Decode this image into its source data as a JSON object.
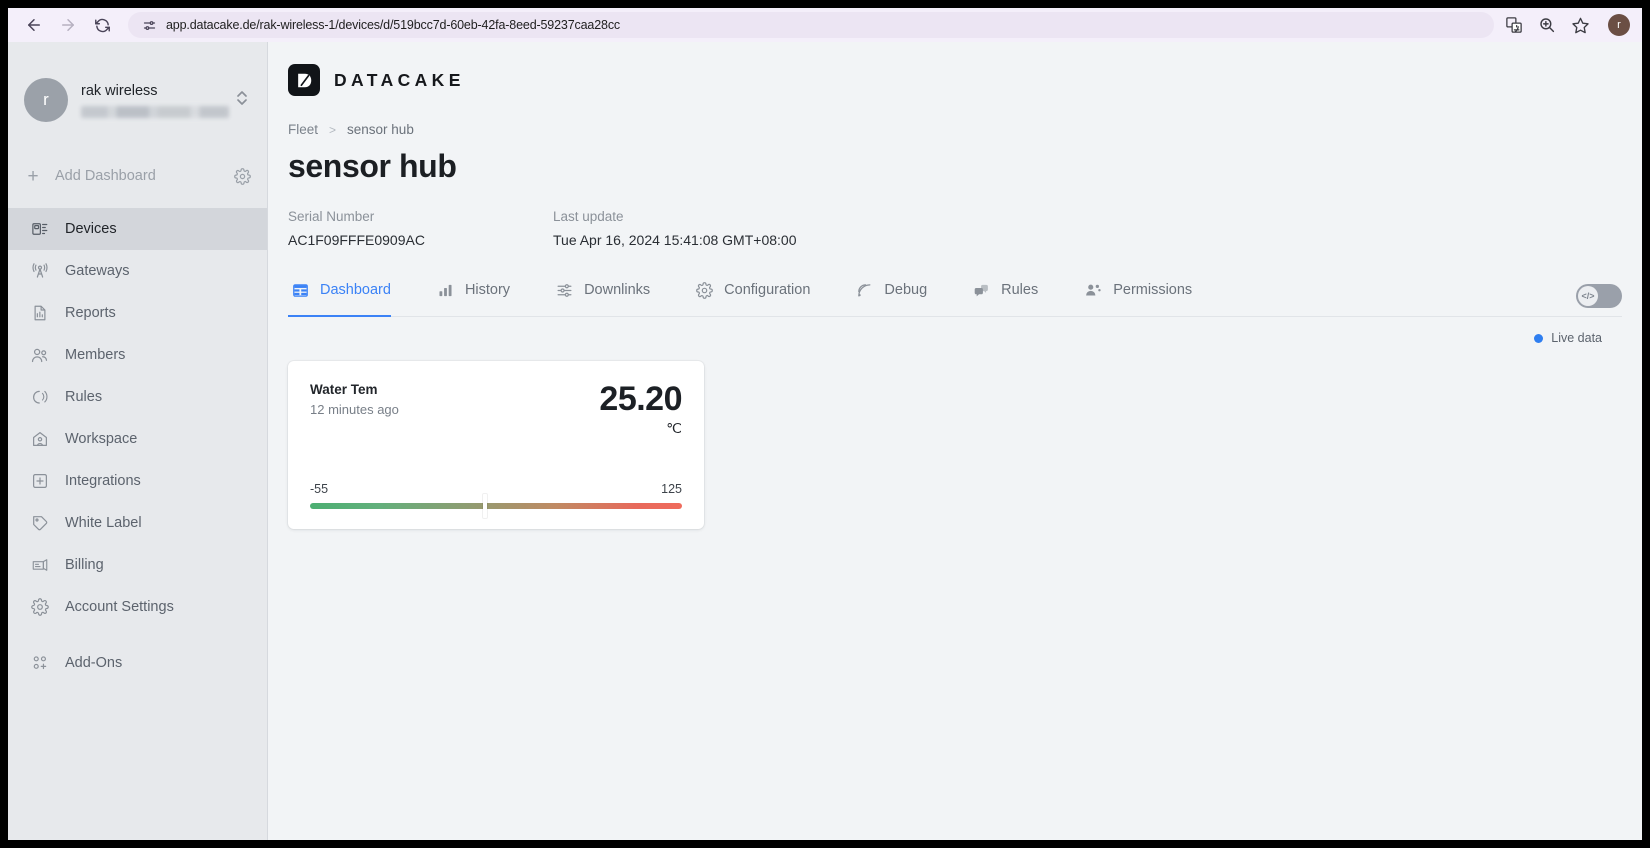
{
  "browser": {
    "url": "app.datacake.de/rak-wireless-1/devices/d/519bcc7d-60eb-42fa-8eed-59237caa28cc",
    "back_label": "Back",
    "forward_label": "Forward",
    "reload_label": "Reload",
    "site_info_label": "View site information",
    "translate_label": "Translate this page",
    "zoom_label": "Zoom",
    "bookmark_label": "Bookmark this tab",
    "profile_initial": "r"
  },
  "sidebar": {
    "workspace": {
      "avatar_initial": "r",
      "name": "rak wireless",
      "subtitle": ""
    },
    "add_dashboard": "Add Dashboard",
    "items": [
      {
        "label": "Devices",
        "icon": "devices-icon",
        "active": true
      },
      {
        "label": "Gateways",
        "icon": "gateway-icon",
        "active": false
      },
      {
        "label": "Reports",
        "icon": "report-icon",
        "active": false
      },
      {
        "label": "Members",
        "icon": "members-icon",
        "active": false
      },
      {
        "label": "Rules",
        "icon": "rules-icon",
        "active": false
      },
      {
        "label": "Workspace",
        "icon": "workspace-icon",
        "active": false
      },
      {
        "label": "Integrations",
        "icon": "integrations-icon",
        "active": false
      },
      {
        "label": "White Label",
        "icon": "tag-icon",
        "active": false
      },
      {
        "label": "Billing",
        "icon": "billing-icon",
        "active": false
      },
      {
        "label": "Account Settings",
        "icon": "gear-icon",
        "active": false
      }
    ],
    "addons": {
      "label": "Add-Ons",
      "icon": "addons-icon"
    }
  },
  "brand": {
    "name": "DATACAKE"
  },
  "breadcrumb": {
    "root": "Fleet",
    "separator": ">",
    "current": "sensor hub"
  },
  "page": {
    "title": "sensor hub",
    "serial_label": "Serial Number",
    "serial_value": "AC1F09FFFE0909AC",
    "last_update_label": "Last update",
    "last_update_value": "Tue Apr 16, 2024 15:41:08 GMT+08:00"
  },
  "tabs": [
    {
      "label": "Dashboard",
      "icon": "dashboard-grid-icon",
      "active": true
    },
    {
      "label": "History",
      "icon": "bar-chart-icon",
      "active": false
    },
    {
      "label": "Downlinks",
      "icon": "sliders-icon",
      "active": false
    },
    {
      "label": "Configuration",
      "icon": "gear-icon",
      "active": false
    },
    {
      "label": "Debug",
      "icon": "signal-icon",
      "active": false
    },
    {
      "label": "Rules",
      "icon": "chat-icon",
      "active": false
    },
    {
      "label": "Permissions",
      "icon": "people-icon",
      "active": false
    }
  ],
  "code_toggle": {
    "label": "</>",
    "state": "off"
  },
  "live_data": {
    "label": "Live data",
    "color": "#2f7ef0"
  },
  "widgets": [
    {
      "title": "Water Tem",
      "subtitle": "12 minutes ago",
      "value": "25.20",
      "unit": "℃",
      "gauge_min": "-55",
      "gauge_max": "125",
      "gauge_percent": 47
    }
  ],
  "colors": {
    "accent": "#3b82f6",
    "sidebar_bg": "#e7e9ec",
    "content_bg": "#f2f4f6",
    "gauge_low": "#4caf72",
    "gauge_high": "#ef6b5c"
  }
}
